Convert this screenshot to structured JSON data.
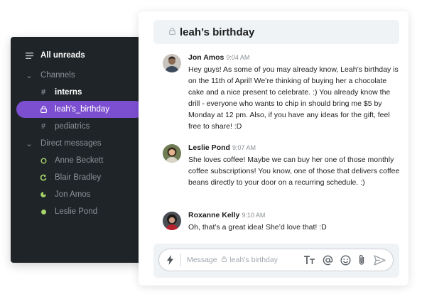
{
  "sidebar": {
    "all_unreads": "All unreads",
    "channels_label": "Channels",
    "channels": [
      {
        "name": "interns",
        "icon": "hash-icon"
      },
      {
        "name": "leah's_birthday",
        "icon": "lock-icon"
      },
      {
        "name": "pediatrics",
        "icon": "hash-icon"
      }
    ],
    "dm_label": "Direct messages",
    "dms": [
      {
        "name": "Anne Beckett",
        "status": "online-ring"
      },
      {
        "name": "Blair Bradley",
        "status": "busy"
      },
      {
        "name": "Jon Amos",
        "status": "away"
      },
      {
        "name": "Leslie Pond",
        "status": "online"
      }
    ],
    "accent": "#7c4fd0",
    "status_color": "#a6d36b"
  },
  "chat": {
    "title": "leah’s birthday",
    "messages": [
      {
        "author": "Jon Amos",
        "time": "9:04 AM",
        "text": "Hey guys! As some of you may already know, Leah’s birthday is on the 11th of April! We’re thinking of buying her a chocolate cake and a nice present to celebrate. :) You already know the drill - everyone who wants to chip in should bring me $5 by Monday at 12 pm. Also, if you have any ideas for the gift, feel free to share! :D"
      },
      {
        "author": "Leslie Pond",
        "time": "9:07 AM",
        "text": "She loves coffee! Maybe we can buy her one of those monthly coffee subscriptions! You know, one of those that delivers coffee beans directly to your door on a recurring schedule. :)"
      },
      {
        "author": "Roxanne Kelly",
        "time": "9:10 AM",
        "text": "Oh, that’s a great idea! She’d love that! :D"
      }
    ]
  },
  "composer": {
    "placeholder_prefix": "Message",
    "placeholder_channel": "leah’s birthday",
    "tools": [
      "text-format-icon",
      "mention-icon",
      "emoji-icon",
      "attach-icon",
      "send-icon"
    ]
  }
}
